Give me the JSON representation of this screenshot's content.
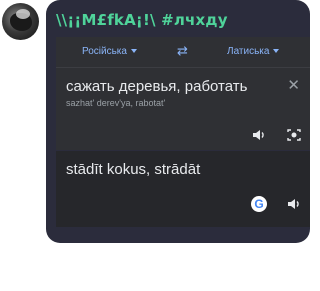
{
  "sender": {
    "name": "\\\\¡¡M£fkA¡!\\ #лчхду"
  },
  "translator": {
    "source_lang": "Російська",
    "target_lang": "Латиська",
    "source_text": "сажать деревья, работать",
    "transliteration": "sazhat' derev'ya, rabotat'",
    "translated_text": "stādīt kokus, strādāt",
    "google_logo_letter": "G"
  },
  "colors": {
    "bubble": "#2b2c3c",
    "sender": "#4fd39a",
    "accent": "#8ab4f8"
  },
  "icons": [
    "avatar",
    "feather-icon",
    "swap-icon",
    "close-icon",
    "speaker-icon",
    "camera-icon",
    "google-icon"
  ]
}
